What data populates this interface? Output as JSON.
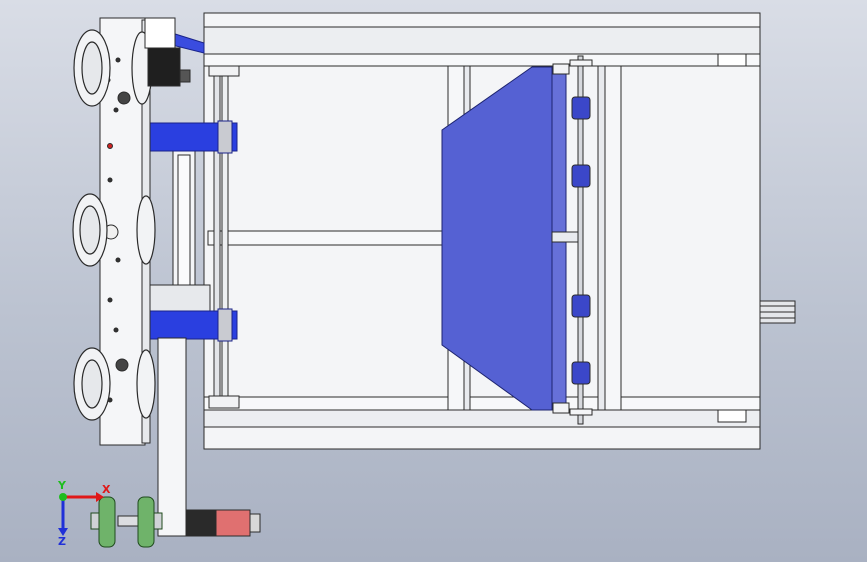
{
  "viewport": {
    "background_top": "#d9dde6",
    "background_bottom": "#a9b1c2"
  },
  "colors": {
    "frame": "#f4f5f7",
    "outline": "#2b2b2b",
    "accent_blue": "#5561d3",
    "bracket_blue": "#2a3fe0",
    "wheel": "#6fb36a",
    "motor_red": "#e07070",
    "dark_part": "#2a2a2a"
  },
  "triad": {
    "x_label": "X",
    "y_label": "Y",
    "z_label": "Z",
    "x_color": "#e01818",
    "y_color": "#1ebd1e",
    "z_color": "#2030d8"
  },
  "icons": {
    "triad": "coordinate-triad-icon"
  }
}
